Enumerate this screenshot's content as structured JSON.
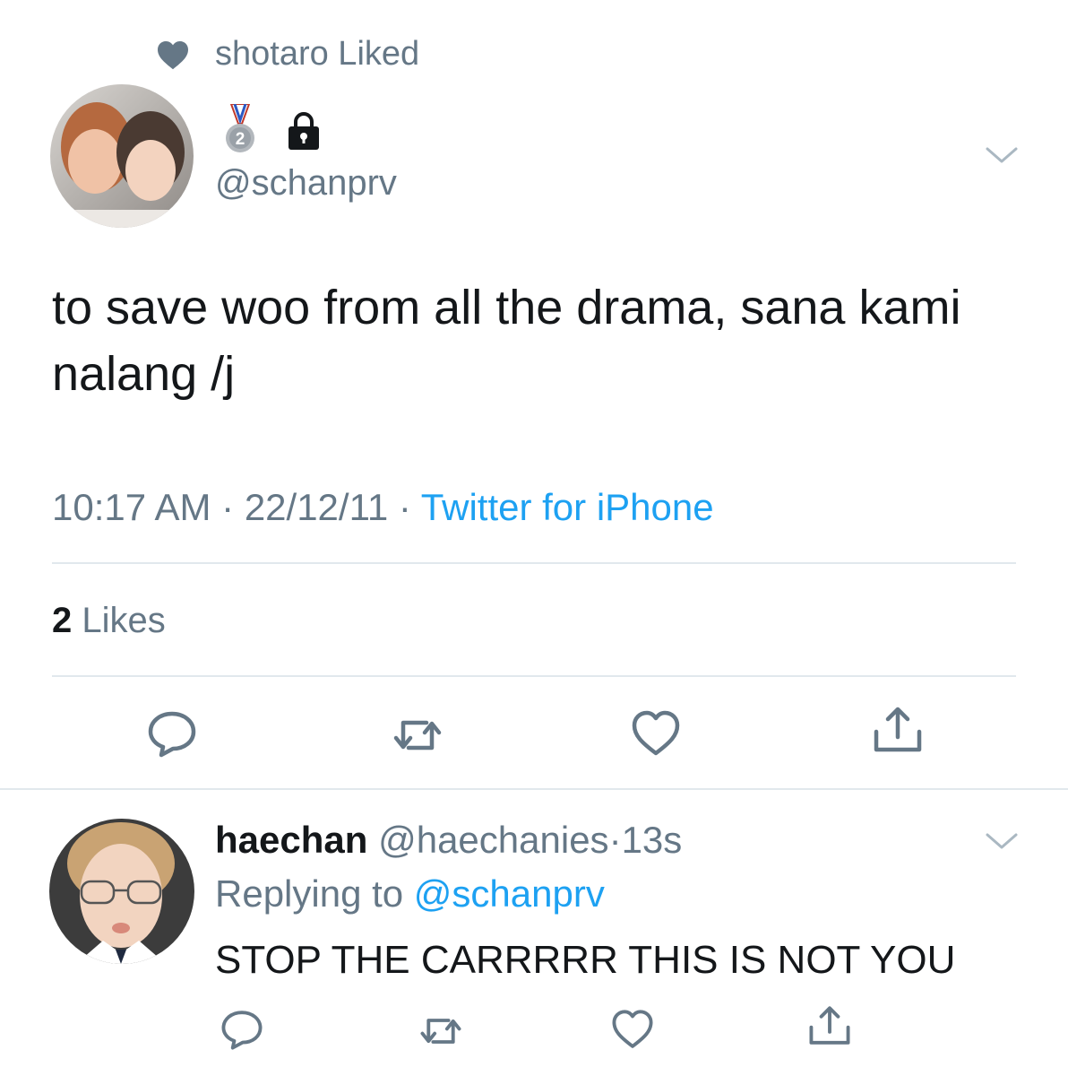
{
  "social_context": {
    "icon": "heart-icon",
    "text": "shotaro Liked"
  },
  "tweet": {
    "badges": [
      "medal-second-place-icon",
      "lock-icon"
    ],
    "handle": "@schanprv",
    "text": "to save woo from all the drama, sana kami nalang /j",
    "time": "10:17 AM",
    "sep": "·",
    "date": "22/12/11",
    "source": "Twitter for iPhone",
    "likes_count": "2",
    "likes_label": "Likes",
    "medal_number": "2"
  },
  "reply": {
    "name": "haechan",
    "handle": "@haechanies",
    "sep": "·",
    "time": "13s",
    "replying_label": "Replying to",
    "replying_to": "@schanprv",
    "text": "STOP THE CARRRRR THIS IS NOT YOU"
  },
  "colors": {
    "secondary": "#657786",
    "accent": "#1da1f2",
    "primary": "#14171a",
    "divider": "#e1e8ed"
  }
}
